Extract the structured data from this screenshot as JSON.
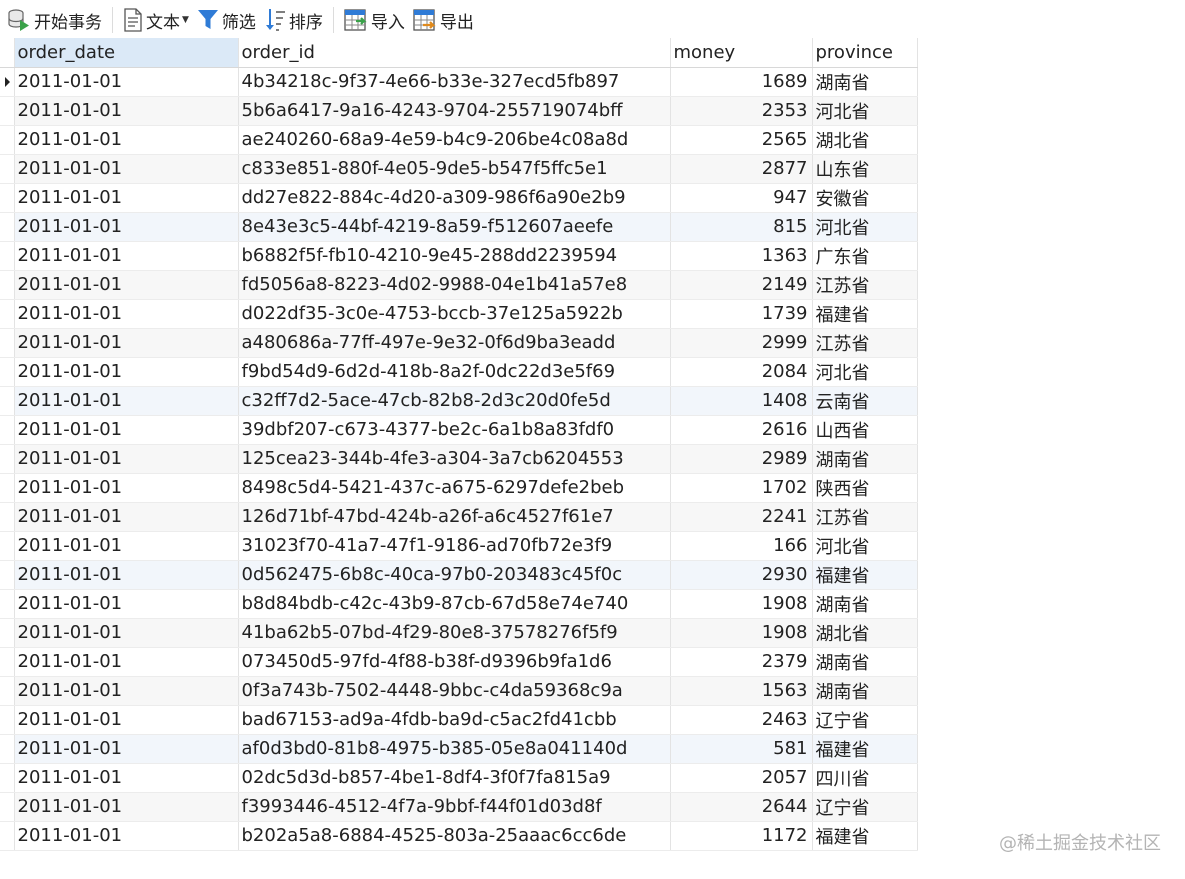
{
  "toolbar": {
    "begin_transaction": "开始事务",
    "text": "文本",
    "filter": "筛选",
    "sort": "排序",
    "import": "导入",
    "export": "导出"
  },
  "columns": [
    "order_date",
    "order_id",
    "money",
    "province"
  ],
  "rows": [
    [
      "2011-01-01",
      "4b34218c-9f37-4e66-b33e-327ecd5fb897",
      "1689",
      "湖南省"
    ],
    [
      "2011-01-01",
      "5b6a6417-9a16-4243-9704-255719074bff",
      "2353",
      "河北省"
    ],
    [
      "2011-01-01",
      "ae240260-68a9-4e59-b4c9-206be4c08a8d",
      "2565",
      "湖北省"
    ],
    [
      "2011-01-01",
      "c833e851-880f-4e05-9de5-b547f5ffc5e1",
      "2877",
      "山东省"
    ],
    [
      "2011-01-01",
      "dd27e822-884c-4d20-a309-986f6a90e2b9",
      "947",
      "安徽省"
    ],
    [
      "2011-01-01",
      "8e43e3c5-44bf-4219-8a59-f512607aeefe",
      "815",
      "河北省"
    ],
    [
      "2011-01-01",
      "b6882f5f-fb10-4210-9e45-288dd2239594",
      "1363",
      "广东省"
    ],
    [
      "2011-01-01",
      "fd5056a8-8223-4d02-9988-04e1b41a57e8",
      "2149",
      "江苏省"
    ],
    [
      "2011-01-01",
      "d022df35-3c0e-4753-bccb-37e125a5922b",
      "1739",
      "福建省"
    ],
    [
      "2011-01-01",
      "a480686a-77ff-497e-9e32-0f6d9ba3eadd",
      "2999",
      "江苏省"
    ],
    [
      "2011-01-01",
      "f9bd54d9-6d2d-418b-8a2f-0dc22d3e5f69",
      "2084",
      "河北省"
    ],
    [
      "2011-01-01",
      "c32ff7d2-5ace-47cb-82b8-2d3c20d0fe5d",
      "1408",
      "云南省"
    ],
    [
      "2011-01-01",
      "39dbf207-c673-4377-be2c-6a1b8a83fdf0",
      "2616",
      "山西省"
    ],
    [
      "2011-01-01",
      "125cea23-344b-4fe3-a304-3a7cb6204553",
      "2989",
      "湖南省"
    ],
    [
      "2011-01-01",
      "8498c5d4-5421-437c-a675-6297defe2beb",
      "1702",
      "陕西省"
    ],
    [
      "2011-01-01",
      "126d71bf-47bd-424b-a26f-a6c4527f61e7",
      "2241",
      "江苏省"
    ],
    [
      "2011-01-01",
      "31023f70-41a7-47f1-9186-ad70fb72e3f9",
      "166",
      "河北省"
    ],
    [
      "2011-01-01",
      "0d562475-6b8c-40ca-97b0-203483c45f0c",
      "2930",
      "福建省"
    ],
    [
      "2011-01-01",
      "b8d84bdb-c42c-43b9-87cb-67d58e74e740",
      "1908",
      "湖南省"
    ],
    [
      "2011-01-01",
      "41ba62b5-07bd-4f29-80e8-37578276f5f9",
      "1908",
      "湖北省"
    ],
    [
      "2011-01-01",
      "073450d5-97fd-4f88-b38f-d9396b9fa1d6",
      "2379",
      "湖南省"
    ],
    [
      "2011-01-01",
      "0f3a743b-7502-4448-9bbc-c4da59368c9a",
      "1563",
      "湖南省"
    ],
    [
      "2011-01-01",
      "bad67153-ad9a-4fdb-ba9d-c5ac2fd41cbb",
      "2463",
      "辽宁省"
    ],
    [
      "2011-01-01",
      "af0d3bd0-81b8-4975-b385-05e8a041140d",
      "581",
      "福建省"
    ],
    [
      "2011-01-01",
      "02dc5d3d-b857-4be1-8df4-3f0f7fa815a9",
      "2057",
      "四川省"
    ],
    [
      "2011-01-01",
      "f3993446-4512-4f7a-9bbf-f44f01d03d8f",
      "2644",
      "辽宁省"
    ],
    [
      "2011-01-01",
      "b202a5a8-6884-4525-803a-25aaac6cc6de",
      "1172",
      "福建省"
    ]
  ],
  "watermark": "@稀土掘金技术社区",
  "colors": {
    "selected_header": "#dbe9f7",
    "icon_blue": "#2f7bd6",
    "icon_green": "#3aa24a",
    "icon_orange": "#e08a1c"
  }
}
